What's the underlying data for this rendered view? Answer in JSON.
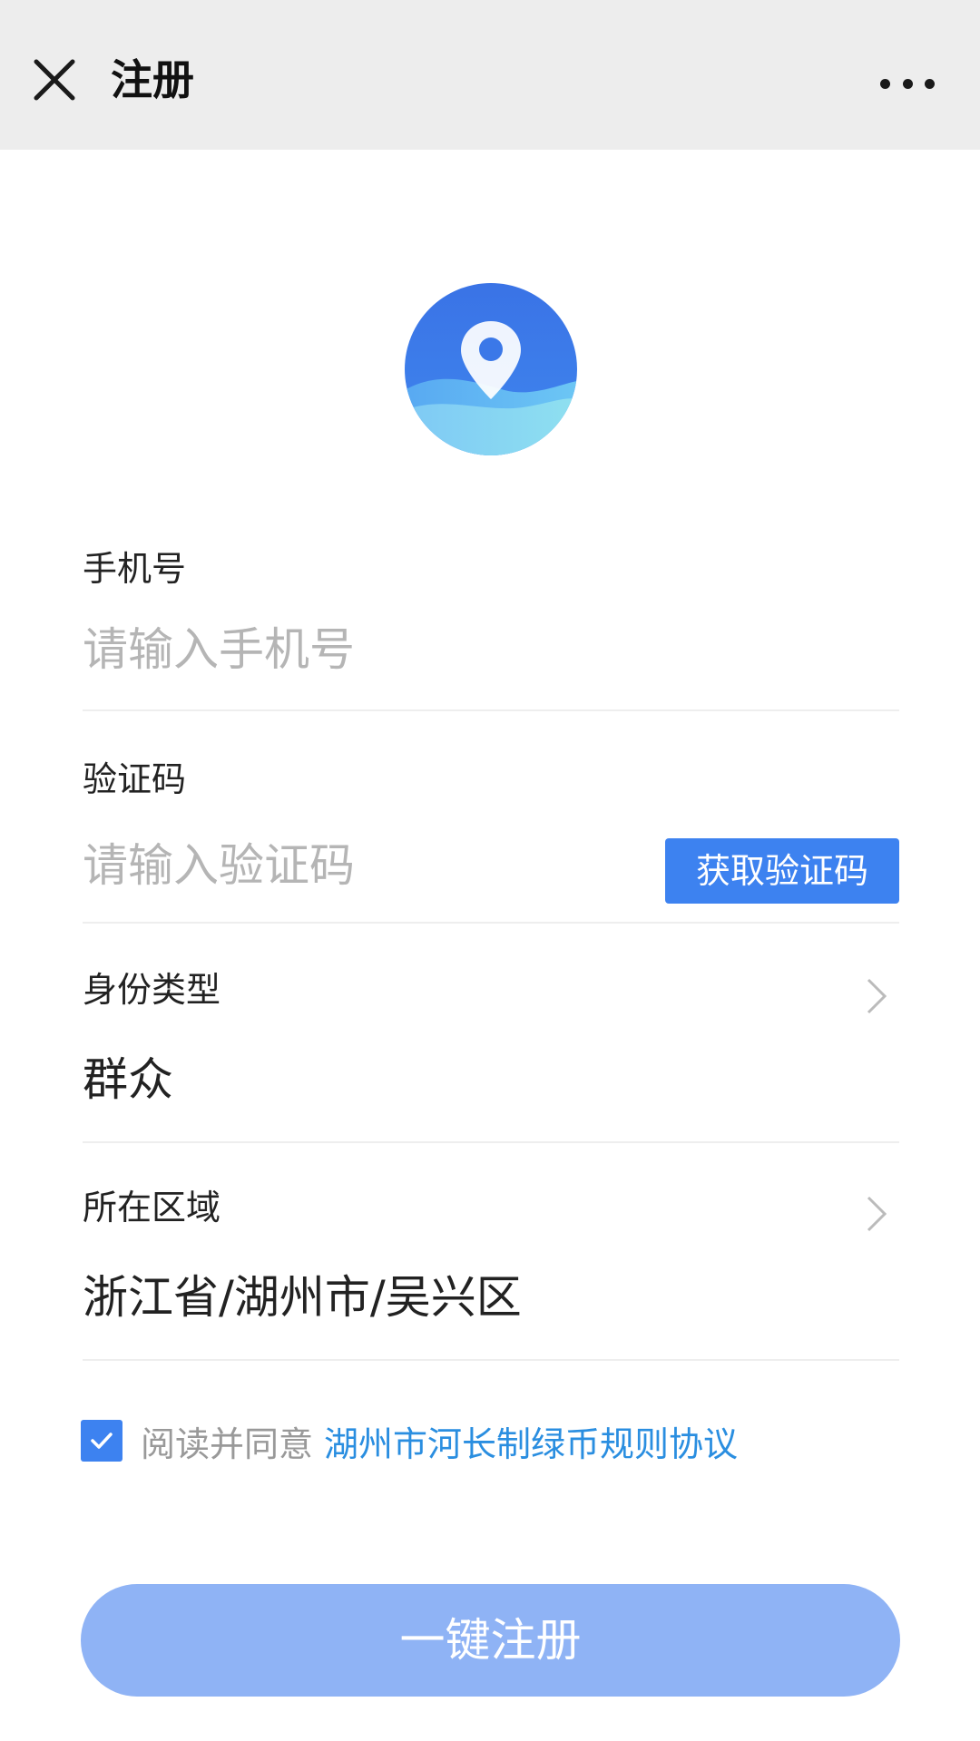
{
  "header": {
    "title": "注册",
    "close_icon": "close-icon",
    "more_icon": "more-icon"
  },
  "logo": {
    "icon": "location-pin-icon",
    "colors": {
      "primary": "#3f7fe8",
      "wave": "#7fd3f2"
    }
  },
  "form": {
    "phone": {
      "label": "手机号",
      "placeholder": "请输入手机号",
      "value": ""
    },
    "code": {
      "label": "验证码",
      "placeholder": "请输入验证码",
      "value": "",
      "button_label": "获取验证码"
    },
    "identity": {
      "label": "身份类型",
      "value": "群众"
    },
    "region": {
      "label": "所在区域",
      "value": "浙江省/湖州市/吴兴区"
    }
  },
  "agreement": {
    "checked": true,
    "text": "阅读并同意",
    "link": "湖州市河长制绿币规则协议"
  },
  "register_button": {
    "label": "一键注册"
  },
  "colors": {
    "accent": "#3d82f0",
    "link": "#2a8ee0",
    "register_disabled": "#8fb3f5",
    "header_bg": "#ededed"
  }
}
